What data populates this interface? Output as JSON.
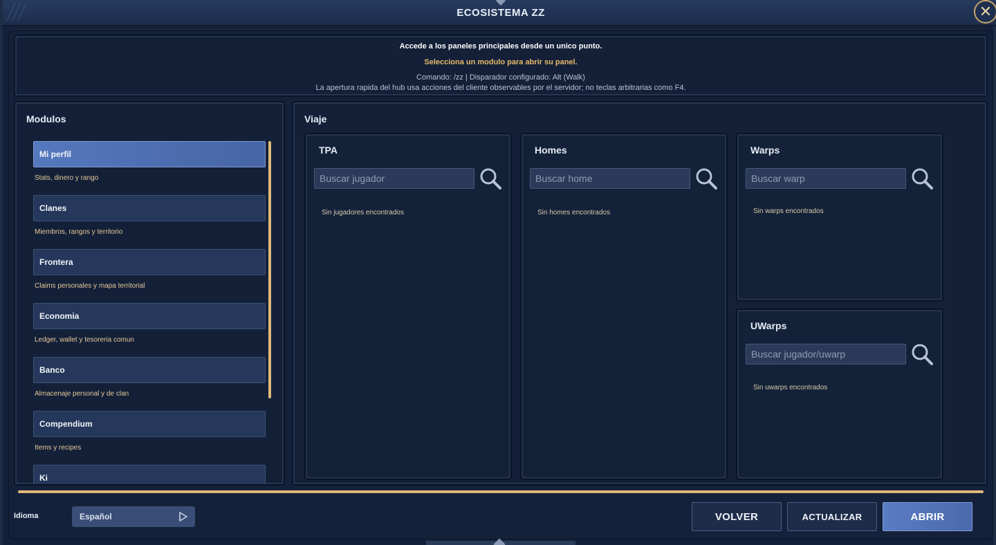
{
  "window": {
    "title": "ECOSISTEMA ZZ",
    "close_glyph": "✕"
  },
  "info": {
    "line1": "Accede a los paneles principales desde un unico punto.",
    "line2": "Selecciona un modulo para abrir su panel.",
    "line3": "Comando: /zz  |  Disparador configurado: Alt (Walk)",
    "line4": "La apertura rapida del hub usa acciones del cliente observables por el servidor; no teclas arbitrarias como F4."
  },
  "modules": {
    "title": "Modulos",
    "items": [
      {
        "label": "Mi perfil",
        "sub": "Stats, dinero y rango",
        "active": true
      },
      {
        "label": "Clanes",
        "sub": "Miembros, rangos y territorio",
        "active": false
      },
      {
        "label": "Frontera",
        "sub": "Claims personales y mapa territorial",
        "active": false
      },
      {
        "label": "Economia",
        "sub": "Ledger, wallet y tesoreria comun",
        "active": false
      },
      {
        "label": "Banco",
        "sub": "Almacenaje personal y de clan",
        "active": false
      },
      {
        "label": "Compendium",
        "sub": "Items y recipes",
        "active": false
      },
      {
        "label": "Ki",
        "sub": "",
        "active": false
      }
    ]
  },
  "viaje": {
    "title": "Viaje",
    "panels": {
      "tpa": {
        "title": "TPA",
        "placeholder": "Buscar jugador",
        "empty": "Sin jugadores encontrados"
      },
      "homes": {
        "title": "Homes",
        "placeholder": "Buscar home",
        "empty": "Sin homes encontrados"
      },
      "warps": {
        "title": "Warps",
        "placeholder": "Buscar warp",
        "empty": "Sin warps encontrados"
      },
      "uwarps": {
        "title": "UWarps",
        "placeholder": "Buscar jugador/uwarp",
        "empty": "Sin uwarps encontrados"
      }
    }
  },
  "footer": {
    "language_label": "Idioma",
    "language_value": "Español",
    "volver": "VOLVER",
    "actualizar": "ACTUALIZAR",
    "abrir": "ABRIR"
  },
  "colors": {
    "background": "#14213a",
    "accent_gold": "#e0b97a",
    "active_blue": "#5578be",
    "subtitle_gold": "#e8c898"
  },
  "icons": {
    "close": "close-icon",
    "search": "search-icon",
    "dropdown": "play-arrow-icon"
  }
}
